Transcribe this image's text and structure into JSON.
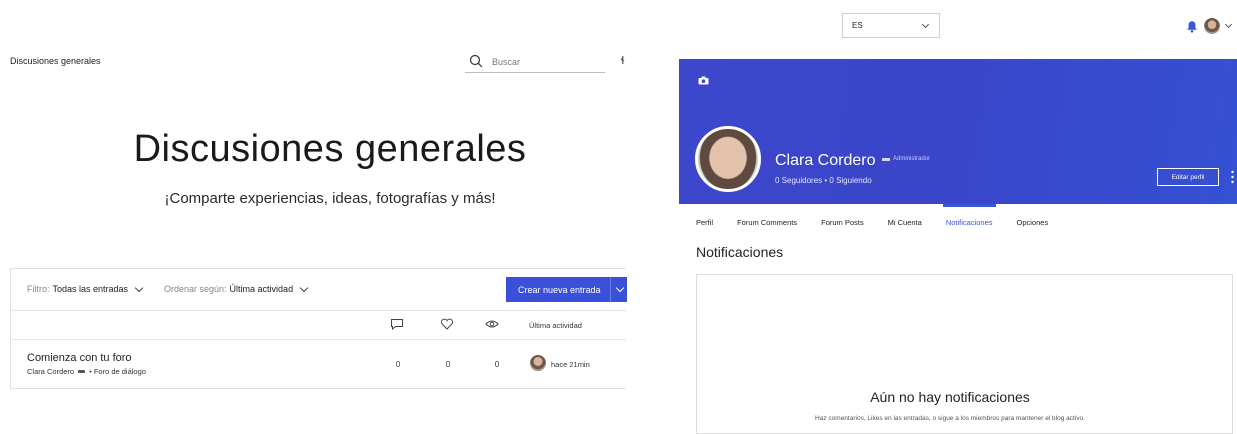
{
  "left": {
    "breadcrumb": "Discusiones generales",
    "search_placeholder": "Buscar",
    "edge_glyph": "ɬ",
    "title": "Discusiones generales",
    "subtitle": "¡Comparte experiencias, ideas, fotografías y más!",
    "filter_label": "Filtro:",
    "filter_value": "Todas las entradas",
    "sort_label": "Ordenar según:",
    "sort_value": "Última actividad",
    "create_button": "Crear nueva entrada",
    "column_last_activity": "Última actividad",
    "posts": [
      {
        "title": "Comienza con tu foro",
        "author": "Clara Cordero",
        "forum": "• Foro de diálogo",
        "comments": "0",
        "likes": "0",
        "views": "0",
        "last_activity": "hace 21min"
      }
    ]
  },
  "right": {
    "language": "ES",
    "profile_name": "Clara Cordero",
    "admin_label": "Administrador",
    "followers": "0 Seguidores • 0 Siguiendo",
    "edit_button": "Editar perfil",
    "tabs": [
      "Perfil",
      "Forum Comments",
      "Forum Posts",
      "Mi Cuenta",
      "Notificaciones",
      "Opciones"
    ],
    "active_tab": "Notificaciones",
    "section_title": "Notificaciones",
    "empty_title": "Aún no hay notificaciones",
    "empty_subtitle": "Haz comentarios, Likes en las entradas, o sigue a los miembros para mantener el blog activo."
  },
  "colors": {
    "accent": "#3a50d9",
    "cover": "#3c47cc"
  }
}
